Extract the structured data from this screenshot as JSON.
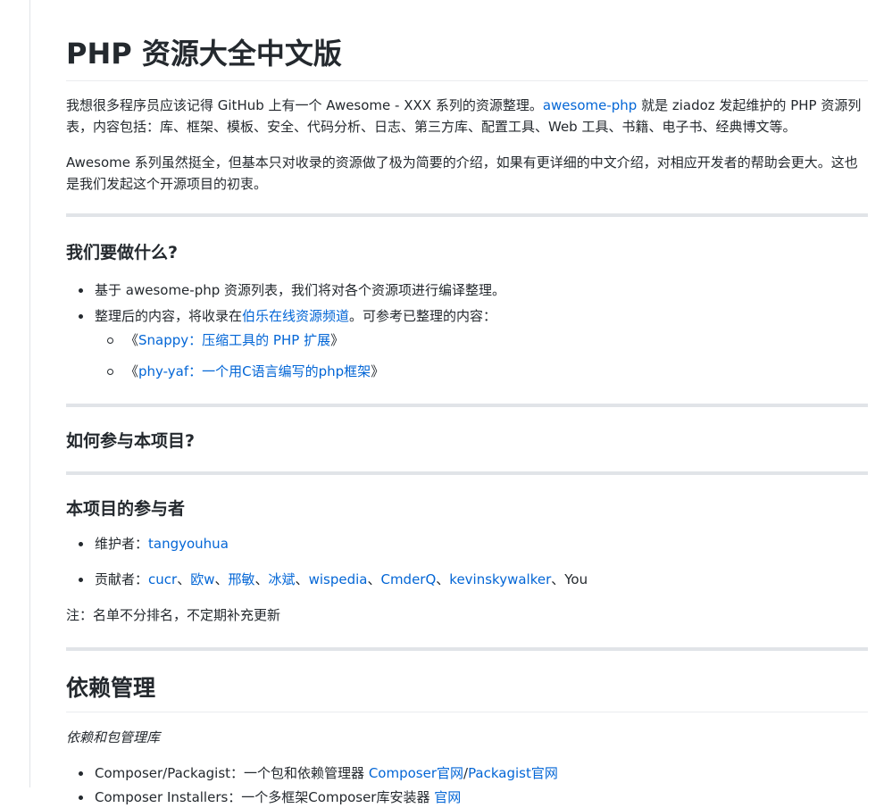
{
  "title": "PHP 资源大全中文版",
  "intro": {
    "p1_a": "我想很多程序员应该记得 GitHub 上有一个 Awesome - XXX 系列的资源整理。",
    "p1_link": "awesome-php",
    "p1_b": " 就是 ziadoz 发起维护的 PHP 资源列表，内容包括：库、框架、模板、安全、代码分析、日志、第三方库、配置工具、Web 工具、书籍、电子书、经典博文等。",
    "p2": "Awesome 系列虽然挺全，但基本只对收录的资源做了极为简要的介绍，如果有更详细的中文介绍，对相应开发者的帮助会更大。这也是我们发起这个开源项目的初衷。"
  },
  "what": {
    "heading": "我们要做什么?",
    "item1": "基于 awesome-php 资源列表，我们将对各个资源项进行编译整理。",
    "item2_a": "整理后的内容，将收录在",
    "item2_link": "伯乐在线资源频道",
    "item2_b": "。可参考已整理的内容：",
    "sub": [
      {
        "open": "《",
        "link": "Snappy：压缩工具的 PHP 扩展",
        "close": "》"
      },
      {
        "open": "《",
        "link": "phy-yaf：一个用C语言编写的php框架",
        "close": "》"
      }
    ]
  },
  "join": {
    "heading": "如何参与本项目?"
  },
  "contributors": {
    "heading": "本项目的参与者",
    "maintainer_label": "维护者：",
    "maintainer": "tangyouhua",
    "contrib_label": "贡献者：",
    "sep": "、",
    "list": [
      "cucr",
      "欧w",
      "邢敏",
      "冰斌",
      "wispedia",
      "CmderQ",
      "kevinskywalker"
    ],
    "last": "You",
    "note": "注：名单不分排名，不定期补充更新"
  },
  "deps": {
    "heading": "依赖管理",
    "subtitle": "依赖和包管理库",
    "item1_text": "Composer/Packagist：一个包和依赖管理器 ",
    "item1_link1": "Composer官网",
    "item1_slash": "/",
    "item1_link2": "Packagist官网",
    "item2_text": "Composer Installers：一个多框架Composer库安装器 ",
    "item2_link": "官网"
  },
  "colors": {
    "link": "#0366d6",
    "text": "#24292e",
    "rule": "#e1e4e8"
  }
}
